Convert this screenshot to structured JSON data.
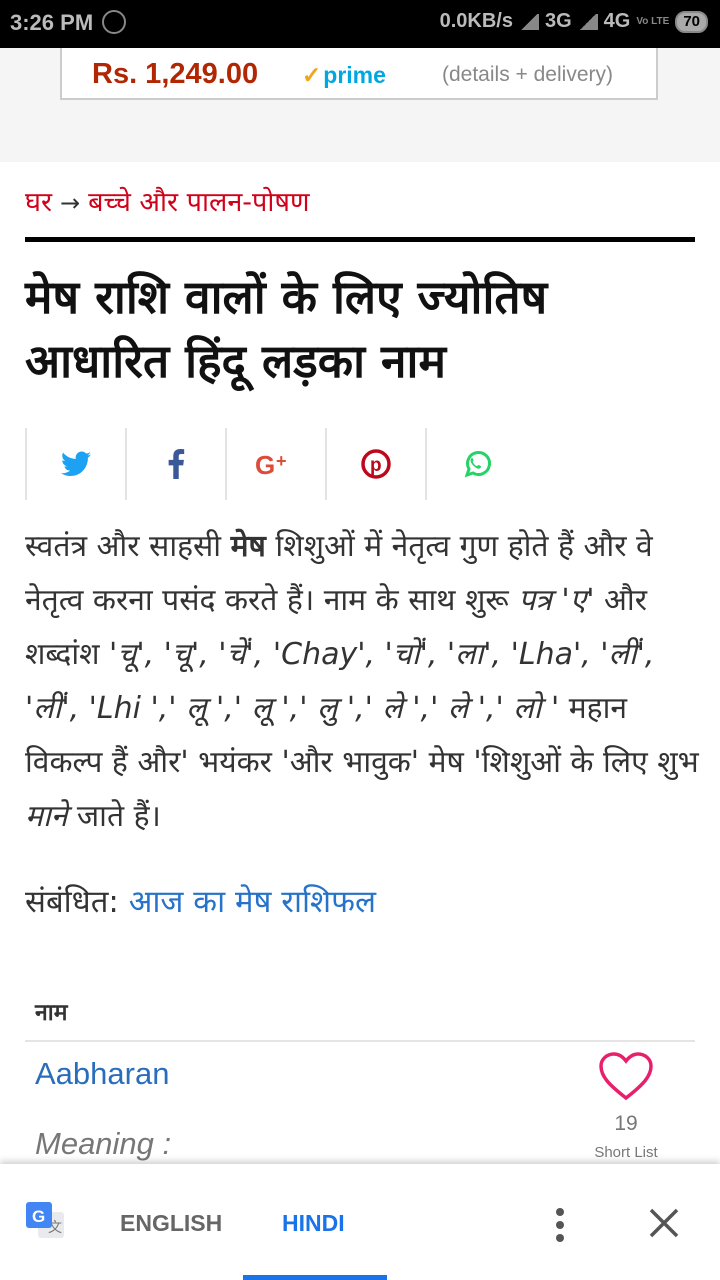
{
  "status_bar": {
    "time": "3:26 PM",
    "network_speed": "0.0KB/s",
    "net1": "3G",
    "net2": "4G",
    "volte": "Vo LTE",
    "battery": "70"
  },
  "ad": {
    "price": "Rs. 1,249.00",
    "prime": "prime",
    "details": "(details + delivery)"
  },
  "breadcrumb": {
    "home": "घर",
    "arrow": "→",
    "section": "बच्चे और पालन-पोषण"
  },
  "article": {
    "title": "मेष राशि वालों के लिए ज्योतिष आधारित हिंदू लड़का नाम",
    "body_part1": "स्वतंत्र और साहसी ",
    "body_bold": "मेष",
    "body_part2": " शिशुओं में नेतृत्व गुण होते हैं और वे नेतृत्व करना पसंद करते हैं। नाम के साथ शुरू ",
    "body_italic1": "पत्र 'ए' ",
    "body_part3": "और शब्दांश ",
    "body_italic2": "'चू', 'चू', 'चें', 'Chay', 'चों', 'ला', 'Lha', 'लीं', 'लीं', 'Lhi ',' लू ',' लू ',' लु ',' ले ',' ले ',' लो '",
    "body_part4": " महान विकल्प हैं और' भयंकर 'और भावुक' मेष 'शिशुओं के लिए शुभ ",
    "body_italic3": "माने",
    "body_part5": " जाते हैं।",
    "related_label": "संबंधित:",
    "related_link": "आज का मेष राशिफल"
  },
  "share_icons": [
    "twitter-icon",
    "facebook-icon",
    "google-plus-icon",
    "pinterest-icon",
    "whatsapp-icon"
  ],
  "table": {
    "header": "नाम",
    "rows": [
      {
        "name": "Aabharan",
        "meaning_label": "Meaning :",
        "count": "19",
        "shortlist_label": "Short List"
      }
    ]
  },
  "translate_bar": {
    "english": "ENGLISH",
    "hindi": "HINDI",
    "active": "HINDI"
  },
  "colors": {
    "accent_red": "#d0021b",
    "link_blue": "#2673c9",
    "translate_blue": "#1a73e8",
    "heart_pink": "#e8206c"
  }
}
